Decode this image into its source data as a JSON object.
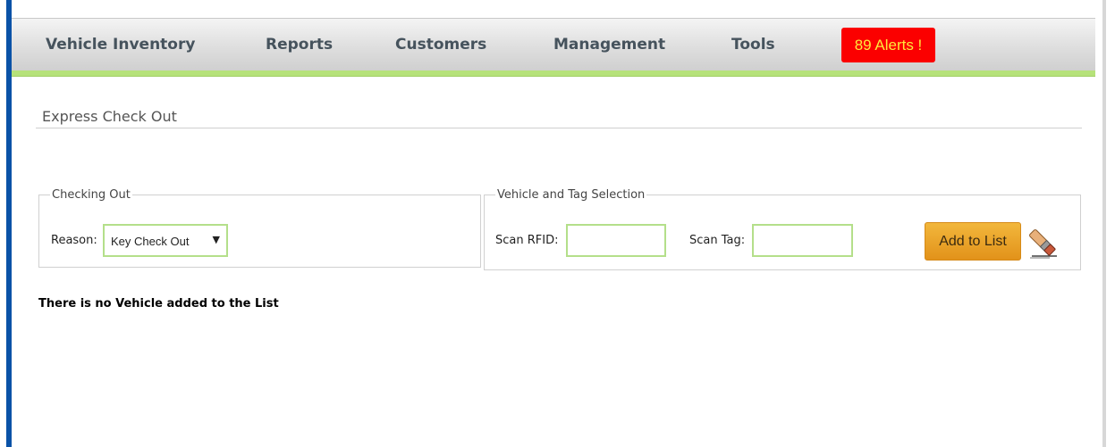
{
  "nav": {
    "items": [
      {
        "label": "Vehicle Inventory"
      },
      {
        "label": "Reports"
      },
      {
        "label": "Customers"
      },
      {
        "label": "Management"
      },
      {
        "label": "Tools"
      }
    ],
    "alerts_label": "89 Alerts !"
  },
  "page": {
    "title": "Express Check Out",
    "empty_message": "There is no Vehicle added to the List"
  },
  "checking_out": {
    "legend": "Checking Out",
    "reason_label": "Reason:",
    "reason_value": "Key Check Out"
  },
  "vehicle_selection": {
    "legend": "Vehicle and Tag Selection",
    "scan_rfid_label": "Scan RFID:",
    "scan_rfid_value": "",
    "scan_tag_label": "Scan Tag:",
    "scan_tag_value": "",
    "add_button_label": "Add to List"
  },
  "colors": {
    "accent_green": "#b6e27a",
    "alert_red": "#fb0000",
    "alert_text": "#ffe83a",
    "button_orange": "#e8a02a",
    "left_stripe": "#0a52a7"
  },
  "icons": {
    "clear": "eraser-icon"
  }
}
